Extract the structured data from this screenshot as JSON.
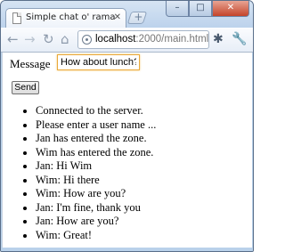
{
  "browser": {
    "tab": {
      "title": "Simple chat o' rama",
      "close_icon": "close-icon",
      "page_icon": "page-icon"
    },
    "new_tab_icon": "new-tab-icon",
    "window_controls": {
      "minimize": "–",
      "maximize": "□",
      "close": "✕"
    },
    "toolbar": {
      "back_icon": "back-arrow-icon",
      "forward_icon": "forward-arrow-icon",
      "reload_icon": "reload-icon",
      "home_icon": "home-icon",
      "url_host": "localhost",
      "url_path": ":2000/main.html",
      "extension_icon": "bug-icon",
      "wrench_icon": "wrench-icon"
    }
  },
  "page": {
    "message_label": "Message",
    "message_input_value": "How about lunch?",
    "send_label": "Send",
    "messages": [
      "Connected to the server.",
      "Please enter a user name ...",
      "Jan has entered the zone.",
      "Wim has entered the zone.",
      "Jan: Hi Wim",
      "Wim: Hi there",
      "Wim: How are you?",
      "Jan: I'm fine, thank you",
      "Jan: How are you?",
      "Wim: Great!"
    ]
  }
}
